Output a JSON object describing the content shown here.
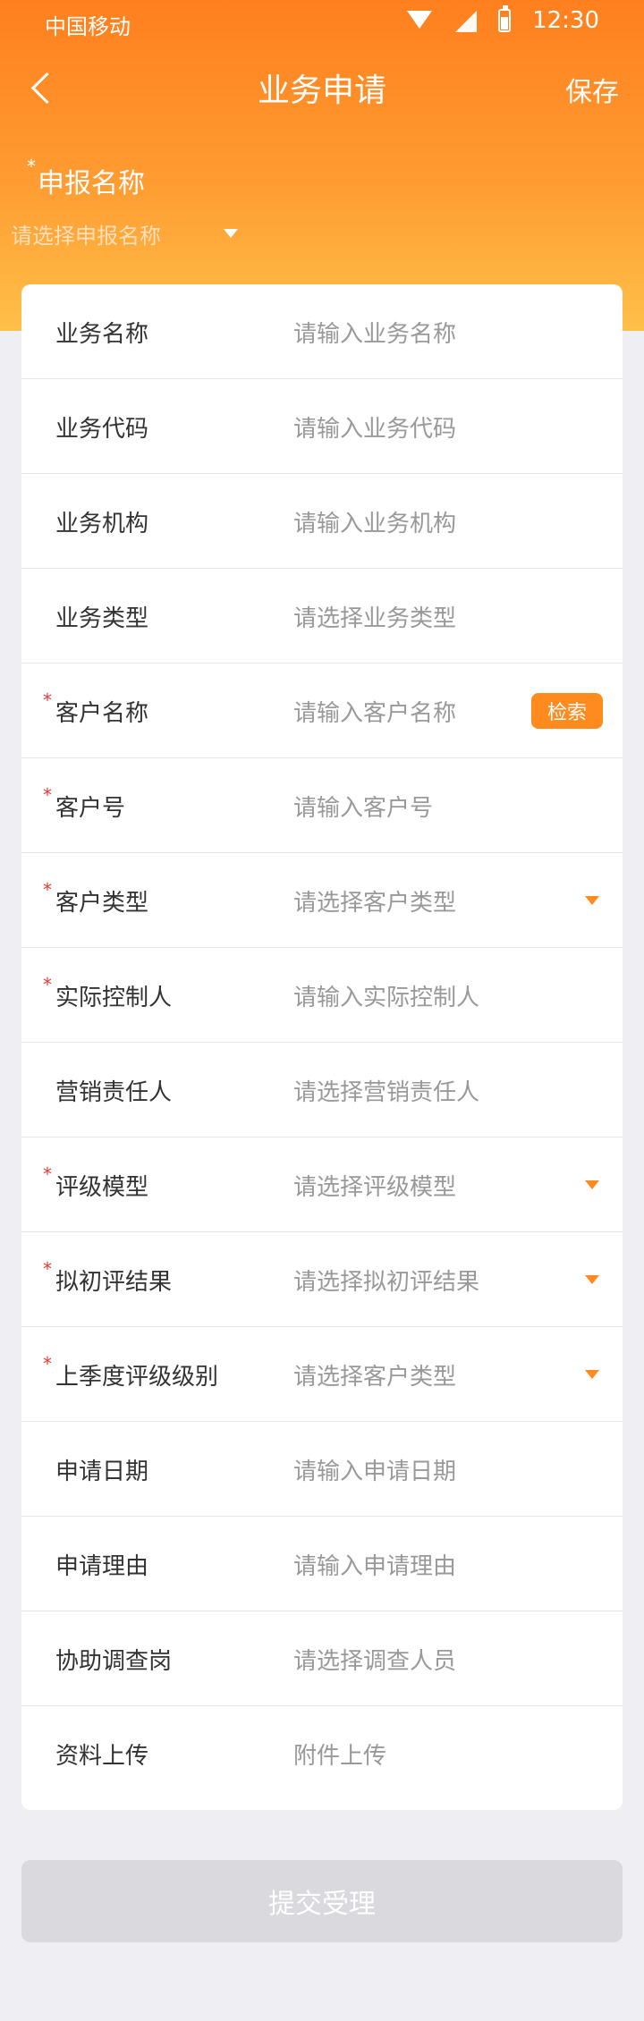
{
  "status_bar": {
    "carrier": "中国移动",
    "time": "12:30"
  },
  "nav": {
    "title": "业务申请",
    "save_label": "保存"
  },
  "apply_name": {
    "required_mark": "*",
    "label": "申报名称",
    "placeholder": "请选择申报名称"
  },
  "form": {
    "rows": [
      {
        "label": "业务名称",
        "required": false,
        "placeholder": "请输入业务名称",
        "trailing": ""
      },
      {
        "label": "业务代码",
        "required": false,
        "placeholder": "请输入业务代码",
        "trailing": ""
      },
      {
        "label": "业务机构",
        "required": false,
        "placeholder": "请输入业务机构",
        "trailing": ""
      },
      {
        "label": "业务类型",
        "required": false,
        "placeholder": "请选择业务类型",
        "trailing": ""
      },
      {
        "label": "客户名称",
        "required": true,
        "placeholder": "请输入客户名称",
        "trailing": "search"
      },
      {
        "label": "客户号",
        "required": true,
        "placeholder": "请输入客户号",
        "trailing": ""
      },
      {
        "label": "客户类型",
        "required": true,
        "placeholder": "请选择客户类型",
        "trailing": "caret"
      },
      {
        "label": "实际控制人",
        "required": true,
        "placeholder": "请输入实际控制人",
        "trailing": ""
      },
      {
        "label": "营销责任人",
        "required": false,
        "placeholder": "请选择营销责任人",
        "trailing": ""
      },
      {
        "label": "评级模型",
        "required": true,
        "placeholder": "请选择评级模型",
        "trailing": "caret"
      },
      {
        "label": "拟初评结果",
        "required": true,
        "placeholder": "请选择拟初评结果",
        "trailing": "caret"
      },
      {
        "label": "上季度评级级别",
        "required": true,
        "placeholder": "请选择客户类型",
        "trailing": "caret"
      },
      {
        "label": "申请日期",
        "required": false,
        "placeholder": "请输入申请日期",
        "trailing": ""
      },
      {
        "label": "申请理由",
        "required": false,
        "placeholder": "请输入申请理由",
        "trailing": ""
      },
      {
        "label": "协助调查岗",
        "required": false,
        "placeholder": "请选择调查人员",
        "trailing": ""
      },
      {
        "label": "资料上传",
        "required": false,
        "placeholder": "附件上传",
        "trailing": ""
      }
    ],
    "search_label": "检索",
    "required_mark": "*"
  },
  "submit_label": "提交受理",
  "colors": {
    "accent": "#FF8A1E",
    "page_bg": "#EFEEF3",
    "label_text": "#333333",
    "placeholder_text": "#999999",
    "divider": "#E6E6E6",
    "submit_bg": "#D9D9DE"
  }
}
